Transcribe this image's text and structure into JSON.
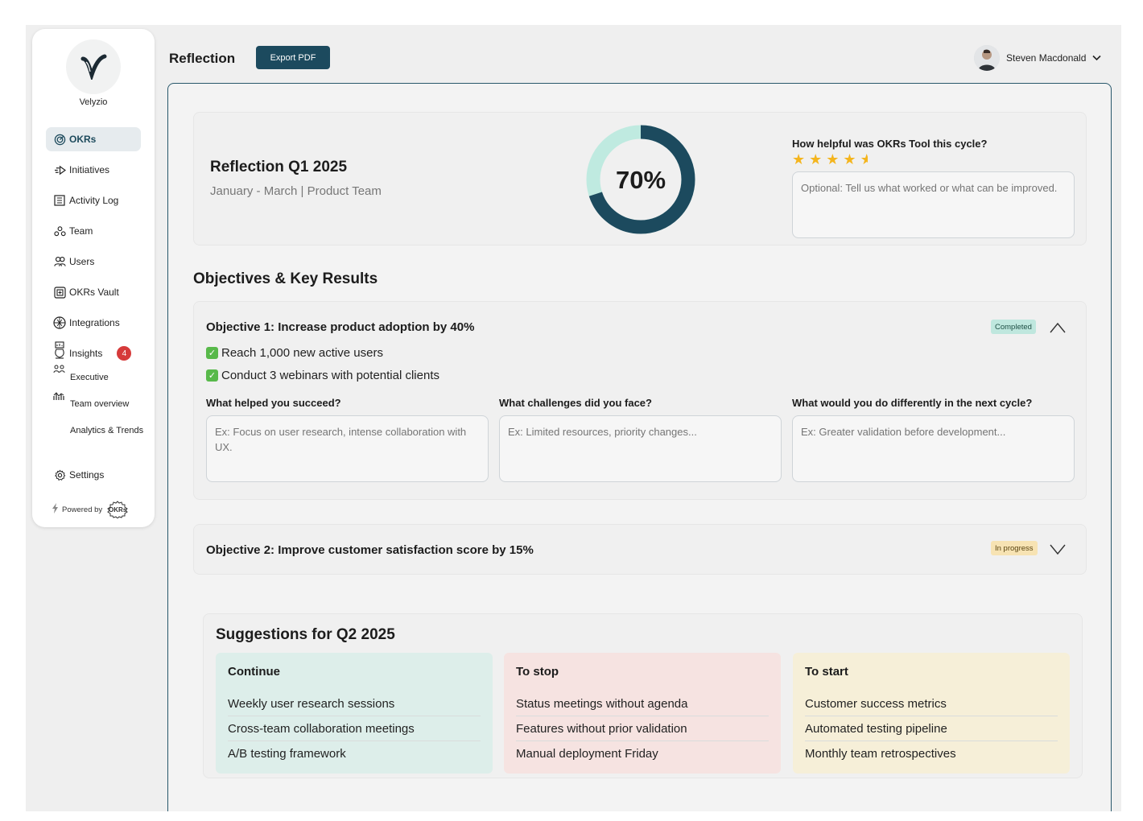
{
  "sidebar": {
    "brand": "Velyzio",
    "items": [
      {
        "label": "OKRs",
        "icon": "okrs-icon"
      },
      {
        "label": "Initiatives",
        "icon": "initiatives-icon"
      },
      {
        "label": "Activity Log",
        "icon": "activity-log-icon"
      },
      {
        "label": "Team",
        "icon": "team-icon"
      },
      {
        "label": "Users",
        "icon": "users-icon"
      },
      {
        "label": "OKRs Vault",
        "icon": "vault-icon"
      },
      {
        "label": "Integrations",
        "icon": "integrations-icon"
      },
      {
        "label": "Insights",
        "icon": "insights-icon",
        "badge": "4"
      }
    ],
    "insights_sub": [
      "Executive",
      "Team overview",
      "Analytics & Trends"
    ],
    "settings": "Settings",
    "powered_by": "Powered by",
    "powered_logo": "OKRs"
  },
  "header": {
    "title": "Reflection",
    "export_label": "Export PDF",
    "user_name": "Steven Macdonald"
  },
  "summary": {
    "title": "Reflection Q1 2025",
    "subtitle": "January - March | Product Team",
    "progress_label": "70%",
    "progress_value": 0.7,
    "question": "How helpful was OKRs Tool this cycle?",
    "rating": 4.5,
    "feedback_placeholder": "Optional: Tell us what worked or what can be improved."
  },
  "section_title": "Objectives & Key Results",
  "objectives": [
    {
      "title": "Objective 1: Increase product adoption by 40%",
      "status": "Completed",
      "key_results": [
        "Reach 1,000 new active users",
        "Conduct 3 webinars with potential clients"
      ],
      "questions": [
        {
          "label": "What helped you succeed?",
          "placeholder": "Ex: Focus on user research, intense collaboration with UX."
        },
        {
          "label": "What challenges did you face?",
          "placeholder": "Ex: Limited resources, priority changes..."
        },
        {
          "label": "What would you do differently in the next cycle?",
          "placeholder": "Ex: Greater validation before development..."
        }
      ]
    },
    {
      "title": "Objective 2: Improve customer satisfaction score by 15%",
      "status": "In progress"
    }
  ],
  "suggestions": {
    "title": "Suggestions for Q2 2025",
    "columns": [
      {
        "heading": "Continue",
        "color": "#ddeeea",
        "items": [
          "Weekly user research sessions",
          "Cross-team collaboration meetings",
          "A/B testing framework"
        ]
      },
      {
        "heading": "To stop",
        "color": "#f6e3e1",
        "items": [
          "Status meetings without agenda",
          "Features without prior validation",
          "Manual deployment Friday"
        ]
      },
      {
        "heading": "To start",
        "color": "#f6efd8",
        "items": [
          "Customer success metrics",
          "Automated testing pipeline",
          "Monthly team retrospectives"
        ]
      }
    ]
  },
  "colors": {
    "primary": "#1c4a5e",
    "donut_track": "#bfeae0",
    "star": "#f4b51e",
    "badge_red": "#d63a3a"
  }
}
